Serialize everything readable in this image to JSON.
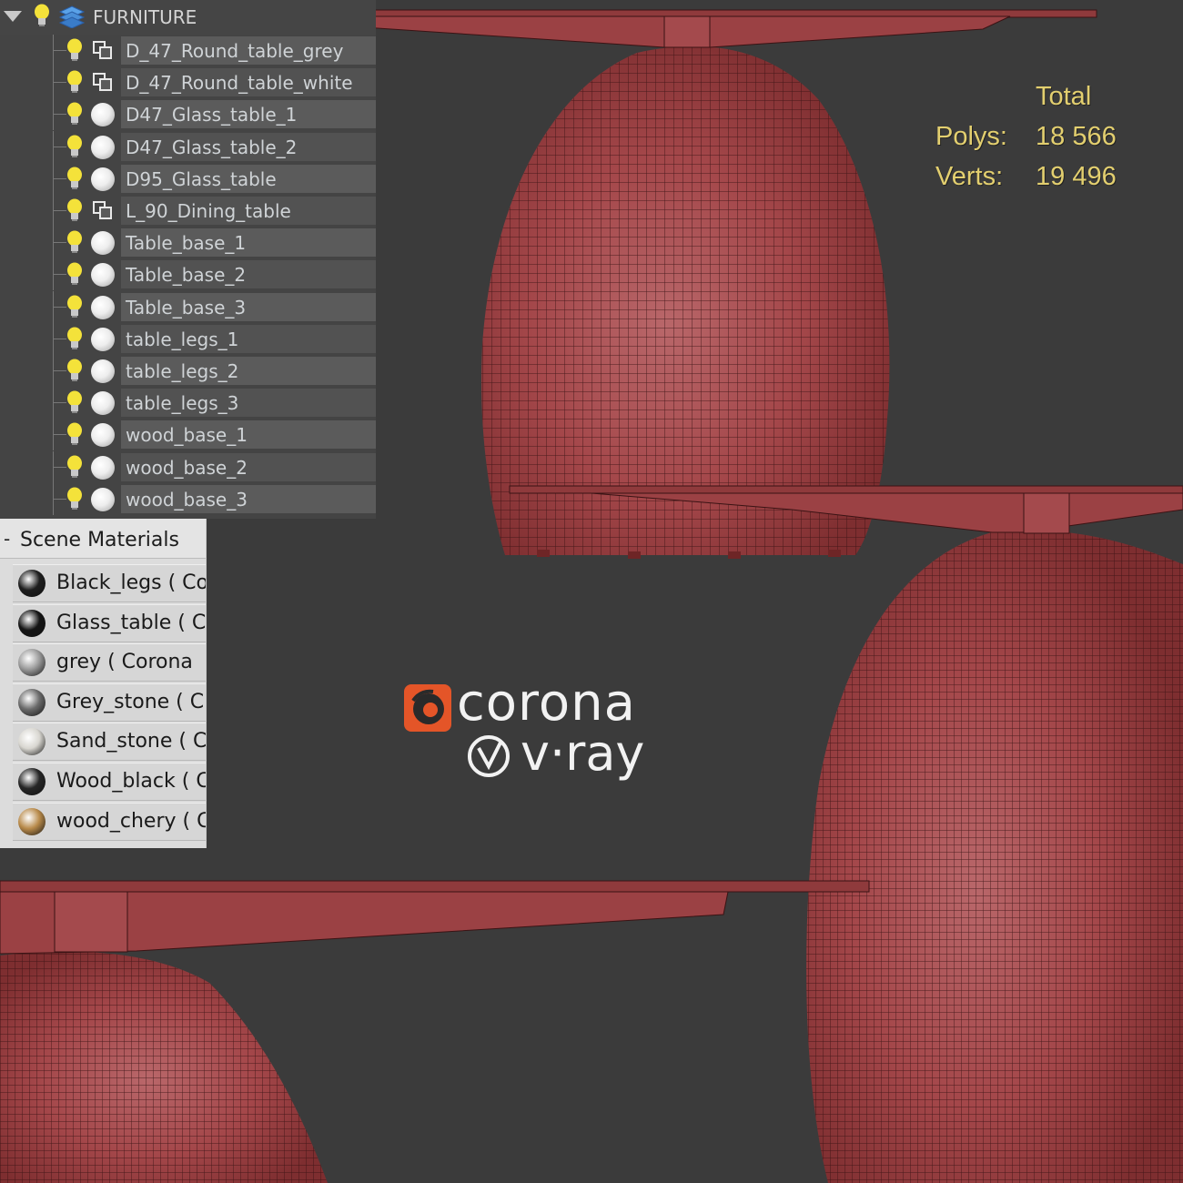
{
  "explorer": {
    "layer": {
      "label": "FURNITURE"
    },
    "objects": [
      {
        "label": "D_47_Round_table_grey",
        "type": "group"
      },
      {
        "label": "D_47_Round_table_white",
        "type": "group"
      },
      {
        "label": "D47_Glass_table_1",
        "type": "object"
      },
      {
        "label": "D47_Glass_table_2",
        "type": "object"
      },
      {
        "label": "D95_Glass_table",
        "type": "object"
      },
      {
        "label": "L_90_Dining_table",
        "type": "group"
      },
      {
        "label": "Table_base_1",
        "type": "object"
      },
      {
        "label": "Table_base_2",
        "type": "object"
      },
      {
        "label": "Table_base_3",
        "type": "object"
      },
      {
        "label": "table_legs_1",
        "type": "object"
      },
      {
        "label": "table_legs_2",
        "type": "object"
      },
      {
        "label": "table_legs_3",
        "type": "object"
      },
      {
        "label": "wood_base_1",
        "type": "object"
      },
      {
        "label": "wood_base_2",
        "type": "object"
      },
      {
        "label": "wood_base_3",
        "type": "object"
      }
    ]
  },
  "materials": {
    "title": "Scene Materials",
    "collapse_label": "-",
    "items": [
      {
        "label": "Black_legs ( Co",
        "color": "#1e1e1e"
      },
      {
        "label": "Glass_table ( C",
        "color": "#151515"
      },
      {
        "label": "grey  ( Corona",
        "color": "#9a9a9a"
      },
      {
        "label": "Grey_stone  ( C",
        "color": "#6a6a6a"
      },
      {
        "label": "Sand_stone  ( C",
        "color": "#d8d6d0"
      },
      {
        "label": "Wood_black  ( C",
        "color": "#262626"
      },
      {
        "label": "wood_chery  ( C",
        "color": "#b88a4a"
      }
    ]
  },
  "stats": {
    "total_label": "Total",
    "polys_label": "Polys:",
    "polys_value": "18 566",
    "verts_label": "Verts:",
    "verts_value": "19 496"
  },
  "logos": {
    "corona": "corona",
    "vray": "v·ray"
  },
  "colors": {
    "viewport_bg": "#3b3b3b",
    "mesh_fill": "#a8484a",
    "mesh_wire": "#3a1314",
    "stats_text": "#e3cf6f",
    "corona_brand": "#e45528"
  }
}
